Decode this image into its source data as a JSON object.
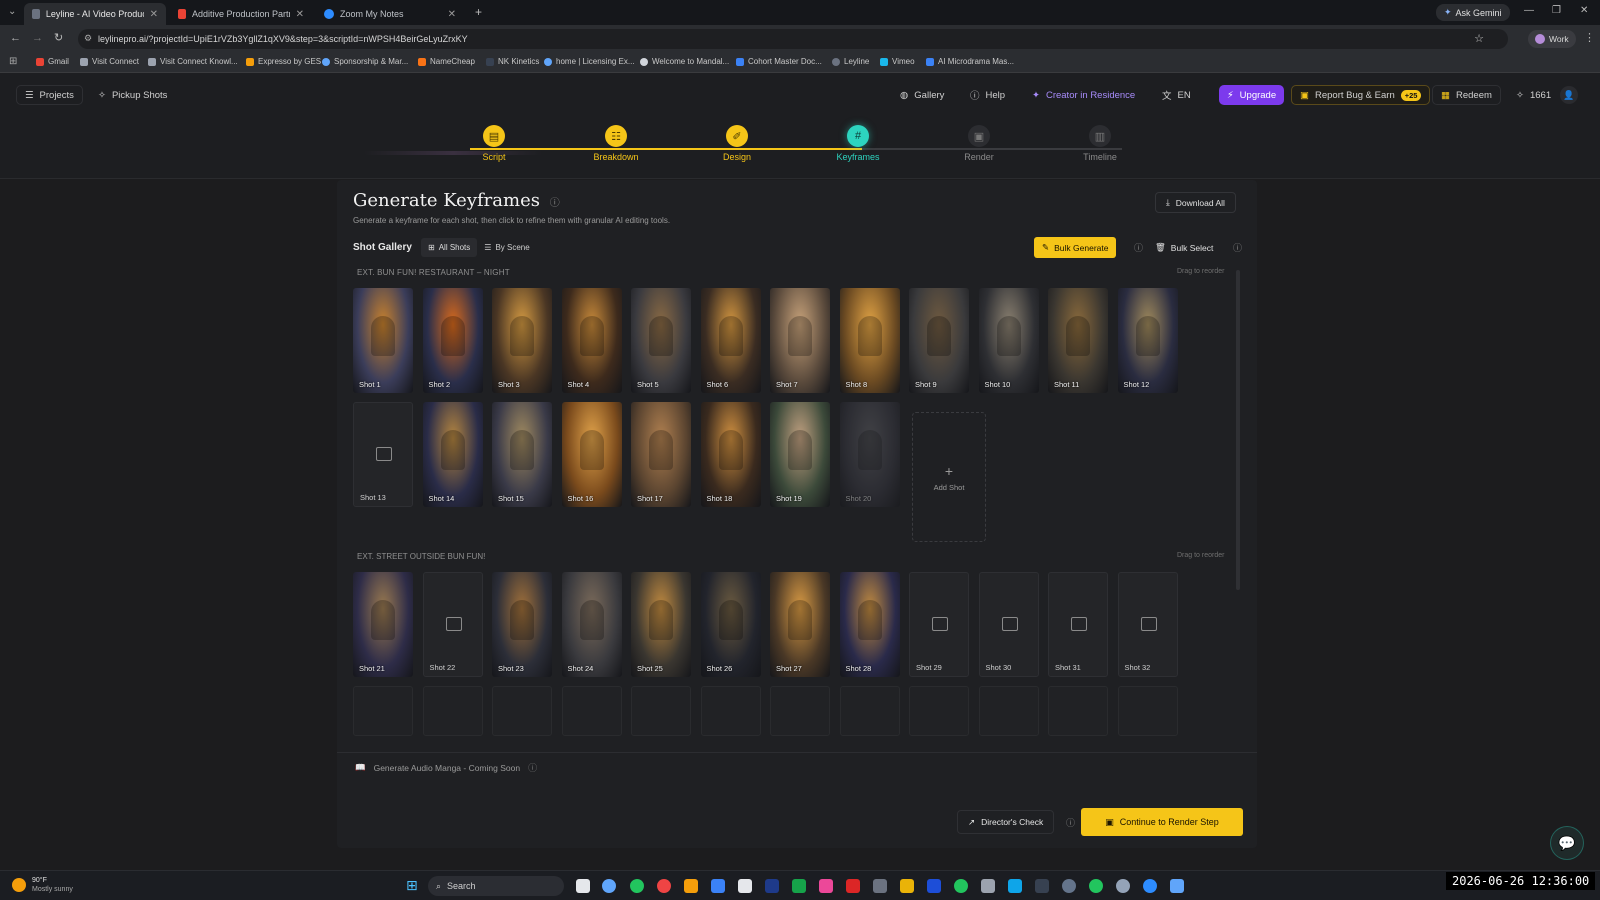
{
  "browser": {
    "tabs": [
      {
        "title": "Leyline - AI Video Production P",
        "color": "#6b7280"
      },
      {
        "title": "Additive Production Partner - n",
        "color": "#ea4335"
      },
      {
        "title": "Zoom My Notes",
        "color": "#2d8cff"
      }
    ],
    "ask_gemini": "Ask Gemini",
    "url": "leylinepro.ai/?projectId=UpiE1rVZb3YgllZ1qXV9&step=3&scriptId=nWPSH4BeirGeLyuZrxKY",
    "profile": "Work",
    "bookmarks": [
      "Gmail",
      "Visit Connect",
      "Visit Connect Knowl...",
      "Expresso by GES",
      "Sponsorship & Mar...",
      "NameCheap",
      "NK Kinetics",
      "home | Licensing Ex...",
      "Welcome to Mandal...",
      "Cohort Master Doc...",
      "Leyline",
      "Vimeo",
      "AI Microdrama Mas..."
    ]
  },
  "header": {
    "projects": "Projects",
    "pickup_shots": "Pickup Shots",
    "gallery": "Gallery",
    "help": "Help",
    "creator": "Creator in Residence",
    "lang": "EN",
    "upgrade": "Upgrade",
    "report_bug": "Report Bug & Earn",
    "report_badge": "+25",
    "redeem": "Redeem",
    "credits": "1661"
  },
  "steps": [
    {
      "label": "Script",
      "state": "done"
    },
    {
      "label": "Breakdown",
      "state": "done"
    },
    {
      "label": "Design",
      "state": "done"
    },
    {
      "label": "Keyframes",
      "state": "current"
    },
    {
      "label": "Render",
      "state": "todo"
    },
    {
      "label": "Timeline",
      "state": "todo"
    }
  ],
  "page": {
    "title": "Generate Keyframes",
    "subtitle": "Generate a keyframe for each shot, then click to refine them with granular AI editing tools.",
    "download_all": "Download All",
    "gallery_label": "Shot Gallery",
    "all_shots": "All Shots",
    "by_scene": "By Scene",
    "bulk_generate": "Bulk Generate",
    "bulk_select": "Bulk Select",
    "drag_hint": "Drag to reorder",
    "add_shot": "Add Shot",
    "audio_manga": "Generate Audio Manga - Coming Soon",
    "directors_check": "Director's Check",
    "continue": "Continue to Render Step"
  },
  "scenes": [
    {
      "name": "EXT. BUN FUN! RESTAURANT – NIGHT",
      "shots": [
        {
          "label": "Shot 1",
          "filled": true,
          "palette": [
            "#3b3d5a",
            "#c9822d"
          ]
        },
        {
          "label": "Shot 2",
          "filled": true,
          "palette": [
            "#2a2e4a",
            "#d96a1c"
          ]
        },
        {
          "label": "Shot 3",
          "filled": true,
          "palette": [
            "#4a3624",
            "#d49a42"
          ]
        },
        {
          "label": "Shot 4",
          "filled": true,
          "palette": [
            "#3d2a1c",
            "#c88a3a"
          ]
        },
        {
          "label": "Shot 5",
          "filled": true,
          "palette": [
            "#3a3a3f",
            "#8a6a44"
          ]
        },
        {
          "label": "Shot 6",
          "filled": true,
          "palette": [
            "#3a2c22",
            "#d39640"
          ]
        },
        {
          "label": "Shot 7",
          "filled": true,
          "palette": [
            "#5a4a3c",
            "#c7a27a"
          ]
        },
        {
          "label": "Shot 8",
          "filled": true,
          "palette": [
            "#6b4a22",
            "#e0a244"
          ]
        },
        {
          "label": "Shot 9",
          "filled": true,
          "palette": [
            "#3a3a3c",
            "#6f5a40"
          ]
        },
        {
          "label": "Shot 10",
          "filled": true,
          "palette": [
            "#2e2f33",
            "#8a8070"
          ]
        },
        {
          "label": "Shot 11",
          "filled": true,
          "palette": [
            "#3a3630",
            "#8a6a3c"
          ]
        },
        {
          "label": "Shot 12",
          "filled": true,
          "palette": [
            "#2a2c40",
            "#a08a5c"
          ]
        },
        {
          "label": "Shot 13",
          "filled": false
        },
        {
          "label": "Shot 14",
          "filled": true,
          "palette": [
            "#2a2c48",
            "#b58640"
          ]
        },
        {
          "label": "Shot 15",
          "filled": true,
          "palette": [
            "#3a3a48",
            "#a08a60"
          ]
        },
        {
          "label": "Shot 16",
          "filled": true,
          "palette": [
            "#7a4a1c",
            "#e0a24a"
          ]
        },
        {
          "label": "Shot 17",
          "filled": true,
          "palette": [
            "#5a4430",
            "#b08050"
          ]
        },
        {
          "label": "Shot 18",
          "filled": true,
          "palette": [
            "#3a2a1e",
            "#d09040"
          ]
        },
        {
          "label": "Shot 19",
          "filled": true,
          "palette": [
            "#3c4a3a",
            "#c0a080"
          ]
        },
        {
          "label": "Shot 20",
          "filled": true,
          "faded": true,
          "palette": [
            "#3a3a44",
            "#6a6a70"
          ]
        }
      ]
    },
    {
      "name": "EXT. STREET OUTSIDE BUN FUN!",
      "shots": [
        {
          "label": "Shot 21",
          "filled": true,
          "palette": [
            "#2e2c48",
            "#9a7a50"
          ]
        },
        {
          "label": "Shot 22",
          "filled": false
        },
        {
          "label": "Shot 23",
          "filled": true,
          "palette": [
            "#2c2e38",
            "#a0703a"
          ]
        },
        {
          "label": "Shot 24",
          "filled": true,
          "palette": [
            "#3a3a3e",
            "#7a6a5a"
          ]
        },
        {
          "label": "Shot 25",
          "filled": true,
          "palette": [
            "#3a3630",
            "#c08a40"
          ]
        },
        {
          "label": "Shot 26",
          "filled": true,
          "palette": [
            "#22242c",
            "#6a5a40"
          ]
        },
        {
          "label": "Shot 27",
          "filled": true,
          "palette": [
            "#4a3826",
            "#d89a44"
          ]
        },
        {
          "label": "Shot 28",
          "filled": true,
          "palette": [
            "#2a2a4a",
            "#c08a40"
          ]
        },
        {
          "label": "Shot 29",
          "filled": false
        },
        {
          "label": "Shot 30",
          "filled": false
        },
        {
          "label": "Shot 31",
          "filled": false
        },
        {
          "label": "Shot 32",
          "filled": false
        }
      ]
    }
  ],
  "taskbar": {
    "weather_temp": "90°F",
    "weather_desc": "Mostly sunny",
    "search": "Search",
    "datetime": "2026-06-26 12:36:00"
  },
  "colors": {
    "accent": "#f5c518",
    "purple": "#7c3aed",
    "teal": "#2dd4bf"
  }
}
